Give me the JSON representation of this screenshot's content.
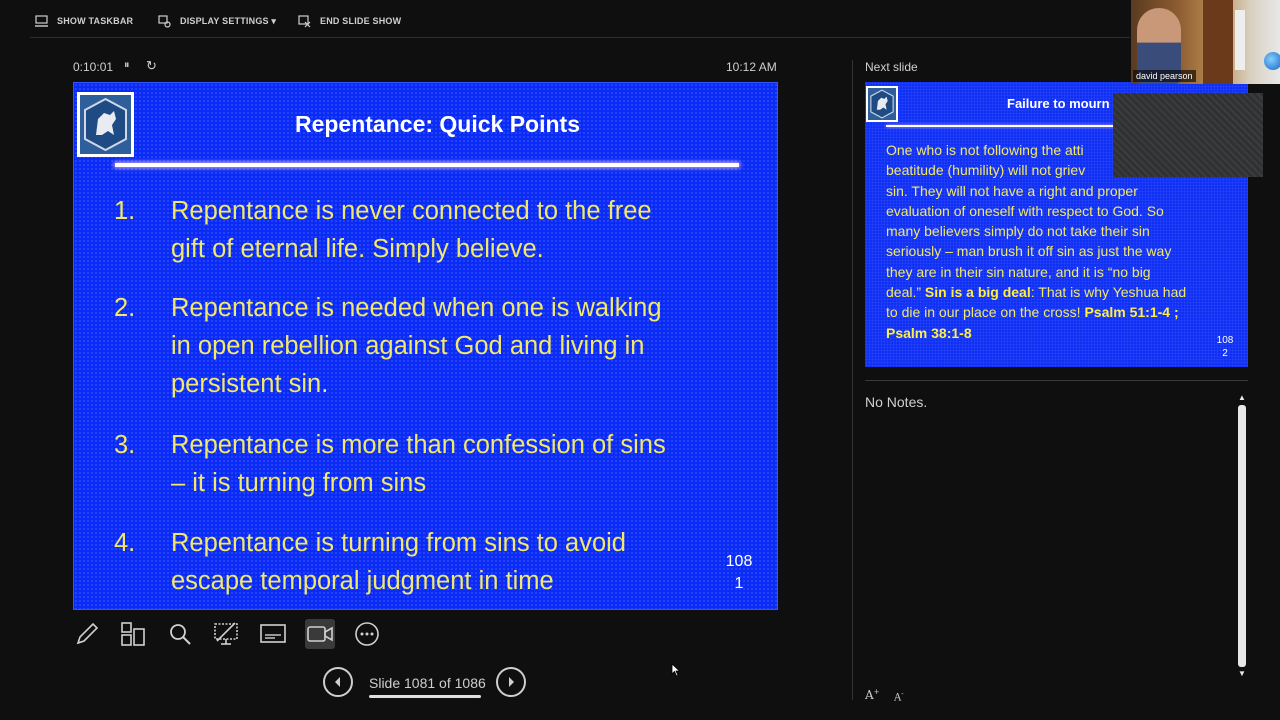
{
  "toolbar": {
    "show_taskbar": "SHOW TASKBAR",
    "display_settings": "DISPLAY SETTINGS ▾",
    "end_slide_show": "END SLIDE SHOW"
  },
  "timer": {
    "elapsed": "0:10:01",
    "clock": "10:12 AM"
  },
  "current_slide": {
    "title": "Repentance: Quick Points",
    "points": [
      {
        "num": "1.",
        "lines": [
          "Repentance is never connected to the free",
          "gift of eternal life. Simply believe."
        ]
      },
      {
        "num": "2.",
        "lines": [
          "Repentance is needed when one is walking",
          "in open rebellion against God and living in",
          "persistent sin."
        ]
      },
      {
        "num": "3.",
        "lines": [
          "Repentance is more than confession of sins",
          "– it is turning from sins"
        ]
      },
      {
        "num": "4.",
        "lines": [
          "Repentance is turning from sins to avoid",
          "escape temporal judgment in time"
        ]
      }
    ],
    "slide_number": [
      "108",
      "1"
    ]
  },
  "navigation": {
    "counter": "Slide 1081 of 1086",
    "progress": 0.995
  },
  "next_slide": {
    "label": "Next slide",
    "title": "Failure to mourn",
    "lines": [
      "One who is not following the atti",
      "beatitude (humility) will not griev",
      "sin. They will not have a right and proper",
      "evaluation of oneself with respect to God.  So",
      "many believers simply do not take their sin",
      "seriously – man brush it off sin as just the way",
      "they are in their sin nature, and it is “no big",
      "deal.”"
    ],
    "bold_a": "Sin is a big deal",
    "line_end": ": That is why Yeshua had",
    "line_last": "to die in our place on the cross!",
    "bold_b": "Psalm 51:1-4 ;",
    "bold_c": "Psalm 38:1-8",
    "slide_number": [
      "108",
      "2"
    ]
  },
  "notes": {
    "text": "No Notes."
  },
  "video": {
    "participant_name": "david pearson"
  },
  "font_buttons": {
    "increase": "A",
    "decrease": "A"
  },
  "colors": {
    "slide_bg": "#0a2bf5",
    "slide_text": "#f2e96b",
    "app_bg": "#0f0f0f"
  }
}
